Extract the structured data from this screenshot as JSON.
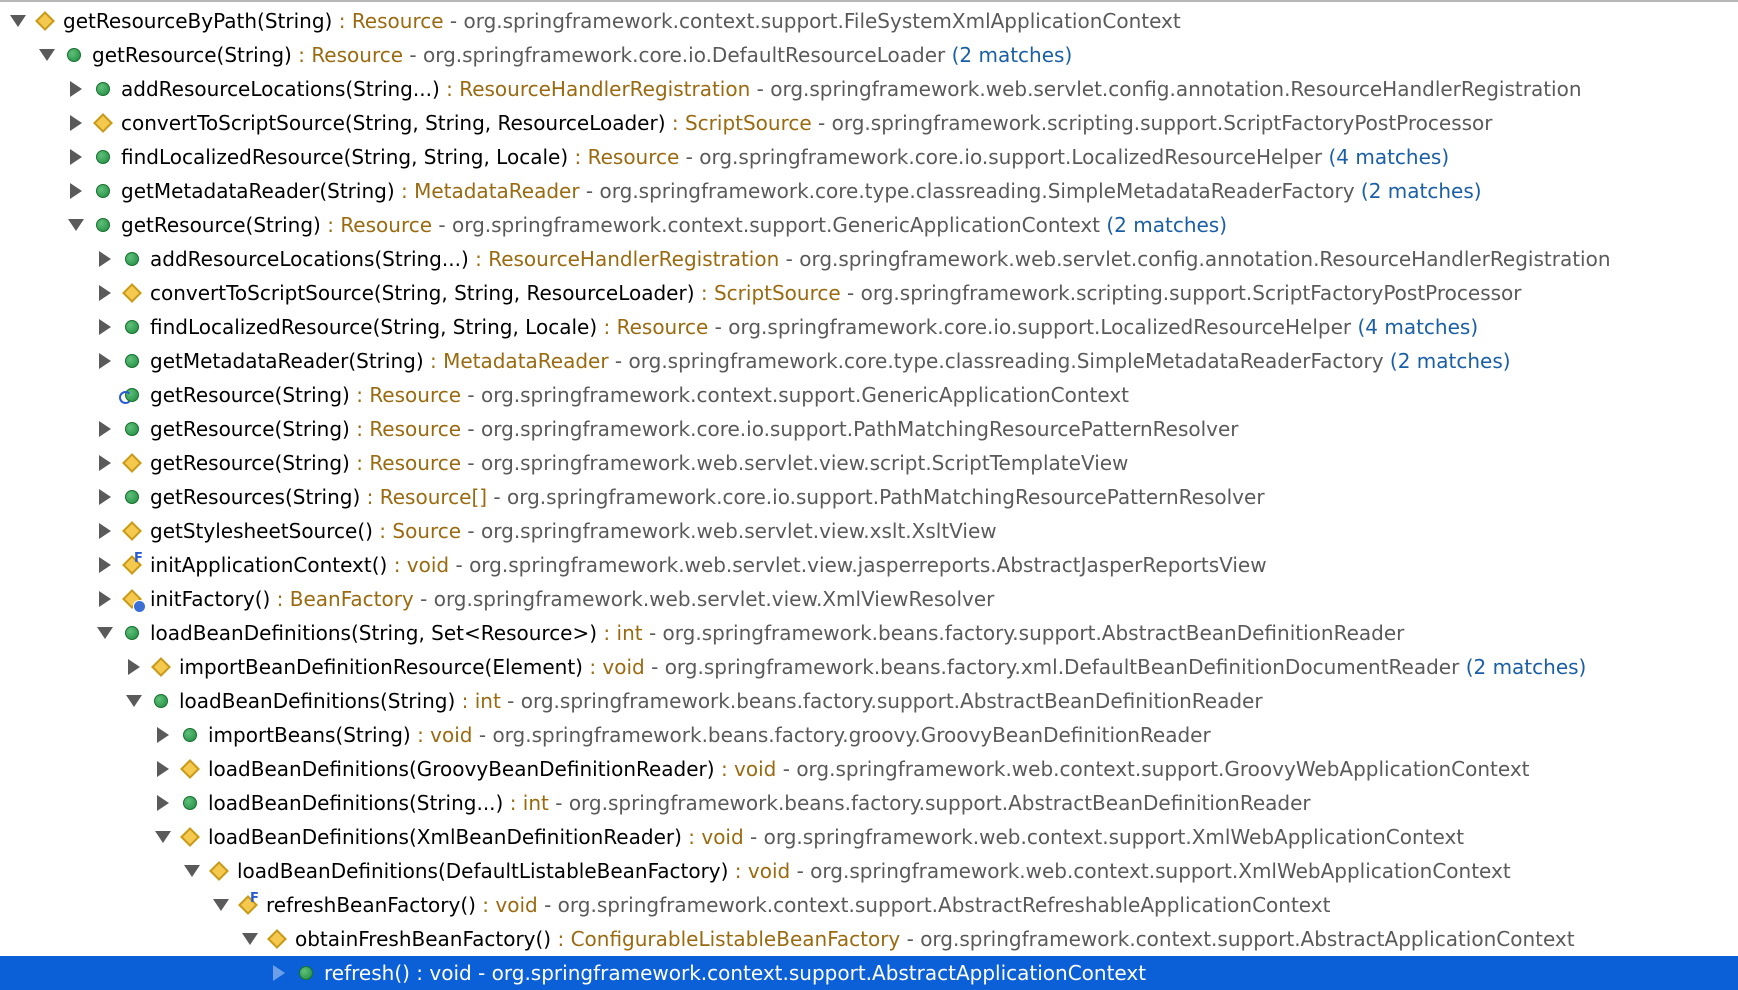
{
  "tree": {
    "rows": [
      {
        "level": 0,
        "twisty": "expanded",
        "icon": "diamond",
        "signature": "getResourceByPath(String)",
        "return_type": "Resource",
        "declaring_class": "org.springframework.context.support.FileSystemXmlApplicationContext",
        "matches": ""
      },
      {
        "level": 1,
        "twisty": "expanded",
        "icon": "green-dot",
        "signature": "getResource(String)",
        "return_type": "Resource",
        "declaring_class": "org.springframework.core.io.DefaultResourceLoader",
        "matches": "(2 matches)"
      },
      {
        "level": 2,
        "twisty": "collapsed",
        "icon": "green-dot",
        "signature": "addResourceLocations(String...)",
        "return_type": "ResourceHandlerRegistration",
        "declaring_class": "org.springframework.web.servlet.config.annotation.ResourceHandlerRegistration",
        "matches": ""
      },
      {
        "level": 2,
        "twisty": "collapsed",
        "icon": "diamond",
        "signature": "convertToScriptSource(String, String, ResourceLoader)",
        "return_type": "ScriptSource",
        "declaring_class": "org.springframework.scripting.support.ScriptFactoryPostProcessor",
        "matches": ""
      },
      {
        "level": 2,
        "twisty": "collapsed",
        "icon": "green-dot",
        "signature": "findLocalizedResource(String, String, Locale)",
        "return_type": "Resource",
        "declaring_class": "org.springframework.core.io.support.LocalizedResourceHelper",
        "matches": "(4 matches)"
      },
      {
        "level": 2,
        "twisty": "collapsed",
        "icon": "green-dot",
        "signature": "getMetadataReader(String)",
        "return_type": "MetadataReader",
        "declaring_class": "org.springframework.core.type.classreading.SimpleMetadataReaderFactory",
        "matches": "(2 matches)"
      },
      {
        "level": 2,
        "twisty": "expanded",
        "icon": "green-dot",
        "signature": "getResource(String)",
        "return_type": "Resource",
        "declaring_class": "org.springframework.context.support.GenericApplicationContext",
        "matches": "(2 matches)"
      },
      {
        "level": 3,
        "twisty": "collapsed",
        "icon": "green-dot",
        "signature": "addResourceLocations(String...)",
        "return_type": "ResourceHandlerRegistration",
        "declaring_class": "org.springframework.web.servlet.config.annotation.ResourceHandlerRegistration",
        "matches": ""
      },
      {
        "level": 3,
        "twisty": "collapsed",
        "icon": "diamond",
        "signature": "convertToScriptSource(String, String, ResourceLoader)",
        "return_type": "ScriptSource",
        "declaring_class": "org.springframework.scripting.support.ScriptFactoryPostProcessor",
        "matches": ""
      },
      {
        "level": 3,
        "twisty": "collapsed",
        "icon": "green-dot",
        "signature": "findLocalizedResource(String, String, Locale)",
        "return_type": "Resource",
        "declaring_class": "org.springframework.core.io.support.LocalizedResourceHelper",
        "matches": "(4 matches)"
      },
      {
        "level": 3,
        "twisty": "collapsed",
        "icon": "green-dot",
        "signature": "getMetadataReader(String)",
        "return_type": "MetadataReader",
        "declaring_class": "org.springframework.core.type.classreading.SimpleMetadataReaderFactory",
        "matches": "(2 matches)"
      },
      {
        "level": 3,
        "twisty": "none",
        "icon": "recursive-green-dot",
        "signature": "getResource(String)",
        "return_type": "Resource",
        "declaring_class": "org.springframework.context.support.GenericApplicationContext",
        "matches": ""
      },
      {
        "level": 3,
        "twisty": "collapsed",
        "icon": "green-dot",
        "signature": "getResource(String)",
        "return_type": "Resource",
        "declaring_class": "org.springframework.core.io.support.PathMatchingResourcePatternResolver",
        "matches": ""
      },
      {
        "level": 3,
        "twisty": "collapsed",
        "icon": "diamond",
        "signature": "getResource(String)",
        "return_type": "Resource",
        "declaring_class": "org.springframework.web.servlet.view.script.ScriptTemplateView",
        "matches": ""
      },
      {
        "level": 3,
        "twisty": "collapsed",
        "icon": "green-dot",
        "signature": "getResources(String)",
        "return_type": "Resource[]",
        "declaring_class": "org.springframework.core.io.support.PathMatchingResourcePatternResolver",
        "matches": ""
      },
      {
        "level": 3,
        "twisty": "collapsed",
        "icon": "diamond",
        "signature": "getStylesheetSource()",
        "return_type": "Source",
        "declaring_class": "org.springframework.web.servlet.view.xslt.XsltView",
        "matches": ""
      },
      {
        "level": 3,
        "twisty": "collapsed",
        "icon": "final-diamond",
        "signature": "initApplicationContext()",
        "return_type": "void",
        "declaring_class": "org.springframework.web.servlet.view.jasperreports.AbstractJasperReportsView",
        "matches": ""
      },
      {
        "level": 3,
        "twisty": "collapsed",
        "icon": "badge-diamond",
        "signature": "initFactory()",
        "return_type": "BeanFactory",
        "declaring_class": "org.springframework.web.servlet.view.XmlViewResolver",
        "matches": ""
      },
      {
        "level": 3,
        "twisty": "expanded",
        "icon": "green-dot",
        "signature": "loadBeanDefinitions(String, Set<Resource>)",
        "return_type": "int",
        "declaring_class": "org.springframework.beans.factory.support.AbstractBeanDefinitionReader",
        "matches": ""
      },
      {
        "level": 4,
        "twisty": "collapsed",
        "icon": "diamond",
        "signature": "importBeanDefinitionResource(Element)",
        "return_type": "void",
        "declaring_class": "org.springframework.beans.factory.xml.DefaultBeanDefinitionDocumentReader",
        "matches": "(2 matches)"
      },
      {
        "level": 4,
        "twisty": "expanded",
        "icon": "green-dot",
        "signature": "loadBeanDefinitions(String)",
        "return_type": "int",
        "declaring_class": "org.springframework.beans.factory.support.AbstractBeanDefinitionReader",
        "matches": ""
      },
      {
        "level": 5,
        "twisty": "collapsed",
        "icon": "green-dot",
        "signature": "importBeans(String)",
        "return_type": "void",
        "declaring_class": "org.springframework.beans.factory.groovy.GroovyBeanDefinitionReader",
        "matches": ""
      },
      {
        "level": 5,
        "twisty": "collapsed",
        "icon": "diamond",
        "signature": "loadBeanDefinitions(GroovyBeanDefinitionReader)",
        "return_type": "void",
        "declaring_class": "org.springframework.web.context.support.GroovyWebApplicationContext",
        "matches": ""
      },
      {
        "level": 5,
        "twisty": "collapsed",
        "icon": "green-dot",
        "signature": "loadBeanDefinitions(String...)",
        "return_type": "int",
        "declaring_class": "org.springframework.beans.factory.support.AbstractBeanDefinitionReader",
        "matches": ""
      },
      {
        "level": 5,
        "twisty": "expanded",
        "icon": "diamond",
        "signature": "loadBeanDefinitions(XmlBeanDefinitionReader)",
        "return_type": "void",
        "declaring_class": "org.springframework.web.context.support.XmlWebApplicationContext",
        "matches": ""
      },
      {
        "level": 6,
        "twisty": "expanded",
        "icon": "diamond",
        "signature": "loadBeanDefinitions(DefaultListableBeanFactory)",
        "return_type": "void",
        "declaring_class": "org.springframework.web.context.support.XmlWebApplicationContext",
        "matches": ""
      },
      {
        "level": 7,
        "twisty": "expanded",
        "icon": "final-diamond",
        "signature": "refreshBeanFactory()",
        "return_type": "void",
        "declaring_class": "org.springframework.context.support.AbstractRefreshableApplicationContext",
        "matches": ""
      },
      {
        "level": 8,
        "twisty": "expanded",
        "icon": "diamond",
        "signature": "obtainFreshBeanFactory()",
        "return_type": "ConfigurableListableBeanFactory",
        "declaring_class": "org.springframework.context.support.AbstractApplicationContext",
        "matches": ""
      },
      {
        "level": 9,
        "twisty": "collapsed",
        "icon": "green-dot",
        "signature": "refresh()",
        "return_type": "void",
        "declaring_class": "org.springframework.context.support.AbstractApplicationContext",
        "matches": "",
        "selected": true
      }
    ]
  },
  "colors": {
    "selection_background": "#0b5fd7",
    "return_type": "#9a6a10",
    "package": "#5a5a5a",
    "matches": "#1a5fa6"
  }
}
